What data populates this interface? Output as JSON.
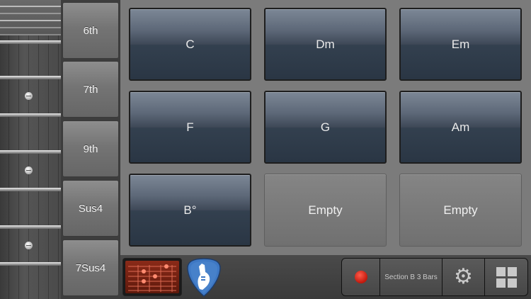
{
  "chord_types": [
    "6th",
    "7th",
    "9th",
    "Sus4",
    "7Sus4"
  ],
  "chords": [
    {
      "label": "C",
      "empty": false
    },
    {
      "label": "Dm",
      "empty": false
    },
    {
      "label": "Em",
      "empty": false
    },
    {
      "label": "F",
      "empty": false
    },
    {
      "label": "G",
      "empty": false
    },
    {
      "label": "Am",
      "empty": false
    },
    {
      "label": "B°",
      "empty": false
    },
    {
      "label": "Empty",
      "empty": true
    },
    {
      "label": "Empty",
      "empty": true
    }
  ],
  "controls": {
    "section_label": "Section B 3 Bars",
    "gear_glyph": "⚙"
  },
  "colors": {
    "chord_button": "#3e4857",
    "record": "#c0180c",
    "pick": "#3e78c4"
  }
}
